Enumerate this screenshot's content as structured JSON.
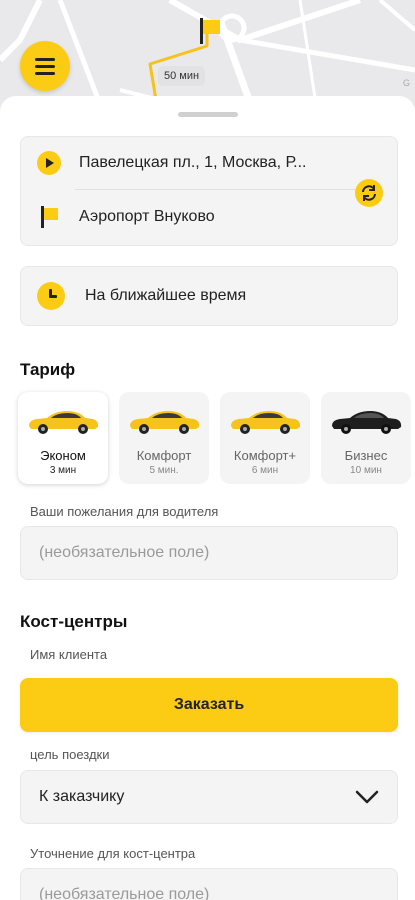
{
  "map": {
    "duration_label": "50 мин",
    "map_credit": "G"
  },
  "route": {
    "from": "Павелецкая пл., 1, Москва, Р...",
    "to": "Аэропорт Внуково"
  },
  "time": {
    "label": "На ближайшее время"
  },
  "tariff": {
    "title": "Тариф",
    "items": [
      {
        "name": "Эконом",
        "eta": "3 мин",
        "car_color": "#f6c21c",
        "active": true
      },
      {
        "name": "Комфорт",
        "eta": "5 мин.",
        "car_color": "#f6c21c",
        "active": false
      },
      {
        "name": "Комфорт+",
        "eta": "6 мин",
        "car_color": "#f6c21c",
        "active": false
      },
      {
        "name": "Бизнес",
        "eta": "10 мин",
        "car_color": "#1e1e1e",
        "active": false
      }
    ]
  },
  "wishes": {
    "label": "Ваши пожелания для водителя",
    "placeholder": "(необязательное поле)"
  },
  "cost_centers": {
    "title": "Кост-центры",
    "client_name_label": "Имя клиента",
    "purpose_label": "цель поездки",
    "purpose_value": "К заказчику",
    "clarification_label": "Уточнение для кост-центра",
    "clarification_placeholder": "(необязательное поле)"
  },
  "order_button": {
    "label": "Заказать"
  },
  "colors": {
    "accent": "#fccc14",
    "field_bg": "#f4f4f5"
  }
}
